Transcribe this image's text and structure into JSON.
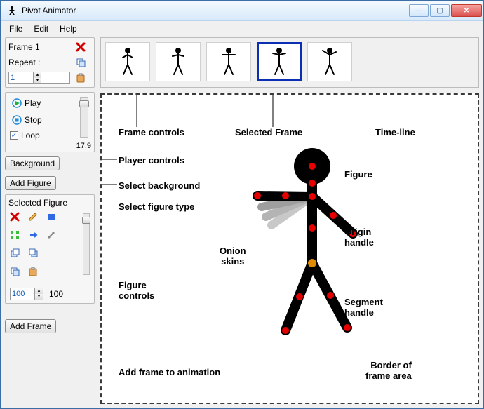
{
  "window": {
    "title": "Pivot Animator"
  },
  "menu": {
    "file": "File",
    "edit": "Edit",
    "help": "Help"
  },
  "frame_controls": {
    "frame_label": "Frame 1",
    "repeat_label": "Repeat :",
    "repeat_value": "1"
  },
  "player": {
    "play": "Play",
    "stop": "Stop",
    "loop": "Loop",
    "loop_checked": "✓",
    "fps": "17.9"
  },
  "buttons": {
    "background": "Background",
    "add_figure": "Add Figure",
    "add_frame": "Add Frame"
  },
  "figure_panel": {
    "header": "Selected Figure",
    "scale_value": "100",
    "scale_readout": "100"
  },
  "timeline": {
    "frames": [
      "f1",
      "f2",
      "f3",
      "f4",
      "f5"
    ],
    "selected_index": 3
  },
  "annotations": {
    "frame_controls": "Frame controls",
    "selected_frame": "Selected Frame",
    "timeline": "Time-line",
    "player_controls": "Player controls",
    "select_background": "Select background",
    "select_figure_type": "Select figure type",
    "figure_controls": "Figure\ncontrols",
    "add_frame": "Add frame to animation",
    "onion": "Onion\nskins",
    "figure": "Figure",
    "origin_handle": "Origin\nhandle",
    "segment_handle": "Segment\nhandle",
    "border": "Border of\nframe area"
  }
}
